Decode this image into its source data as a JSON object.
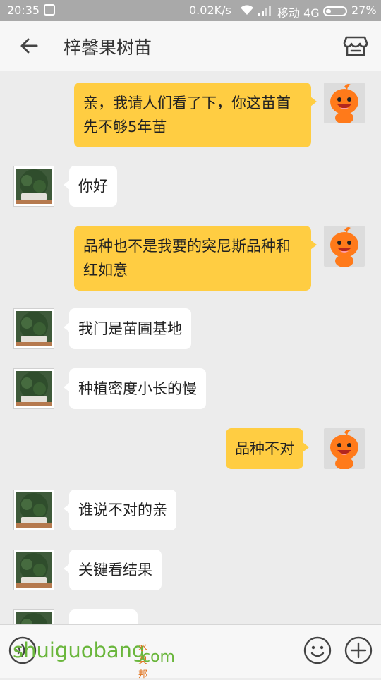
{
  "status_bar": {
    "time": "20:35",
    "speed": "0.02K/s",
    "carrier": "移动 4G",
    "battery_percent": "27%",
    "battery_level": 0.27
  },
  "header": {
    "title": "梓馨果树苗",
    "back_icon": "arrow-left-icon",
    "store_icon": "store-icon"
  },
  "messages": [
    {
      "side": "right",
      "text": "亲，我请人们看了下，你这苗首先不够5年苗",
      "avatar": "orange-mascot-avatar"
    },
    {
      "side": "left",
      "text": "你好",
      "avatar": "shop-tree-avatar"
    },
    {
      "side": "right",
      "text": "品种也不是我要的突尼斯品种和红如意",
      "avatar": "orange-mascot-avatar"
    },
    {
      "side": "left",
      "text": "我门是苗圃基地",
      "avatar": "shop-tree-avatar"
    },
    {
      "side": "left",
      "text": "种植密度小长的慢",
      "avatar": "shop-tree-avatar"
    },
    {
      "side": "right",
      "text": "品种不对",
      "avatar": "orange-mascot-avatar"
    },
    {
      "side": "left",
      "text": "谁说不对的亲",
      "avatar": "shop-tree-avatar"
    },
    {
      "side": "left",
      "text": "关键看结果",
      "avatar": "shop-tree-avatar"
    },
    {
      "side": "left",
      "text": "",
      "avatar": "shop-tree-avatar"
    }
  ],
  "input_bar": {
    "voice_icon": "voice-icon",
    "emoji_icon": "emoji-icon",
    "plus_icon": "plus-icon"
  },
  "watermark": {
    "text": "shuiguobang",
    "cn": "水果邦",
    "com": ".com"
  },
  "colors": {
    "bubble_right": "#ffcd42",
    "bubble_left": "#ffffff",
    "chat_background": "#ececec",
    "status_bar": "#a9a9a9"
  }
}
